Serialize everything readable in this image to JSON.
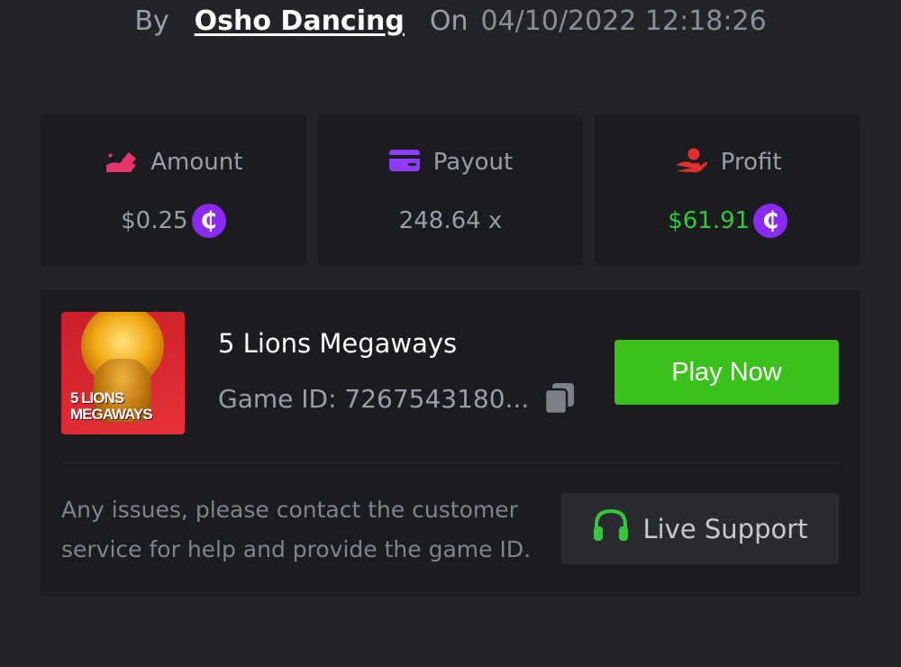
{
  "byline": {
    "by": "By",
    "author": "Osho Dancing",
    "on": "On",
    "datetime": "04/10/2022 12:18:26"
  },
  "stats": [
    {
      "label": "Amount",
      "value": "$0.25",
      "icon": "amount-icon",
      "coin": "₵",
      "value_color": "#9a9ea7"
    },
    {
      "label": "Payout",
      "value": "248.64 x",
      "icon": "card-icon"
    },
    {
      "label": "Profit",
      "value": "$61.91",
      "icon": "hand-icon",
      "coin": "₵",
      "value_color": "#35c63b"
    }
  ],
  "game": {
    "thumb_line1": "5 LIONS",
    "thumb_line2": "MEGAWAYS",
    "title": "5 Lions Megaways",
    "id_label": "Game ID: 7267543180...",
    "play_label": "Play Now"
  },
  "support": {
    "notice": "Any issues, please contact the customer service for help and provide the game ID.",
    "button_label": "Live Support"
  },
  "colors": {
    "accent_green": "#3bc11b",
    "coin_purple": "#8c2af5",
    "amount_pink": "#e5356b",
    "payout_purple": "#8c3df5",
    "profit_red": "#e2302f"
  }
}
